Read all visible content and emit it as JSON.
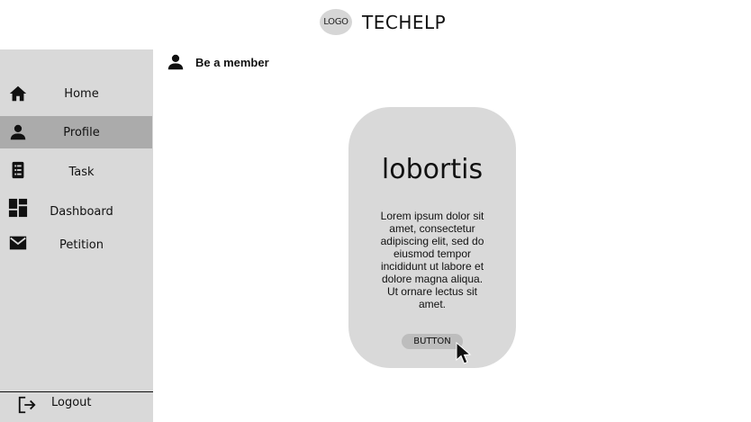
{
  "header": {
    "logo": "LOGO",
    "brand": "TECHELP"
  },
  "sidebar": {
    "items": [
      {
        "label": "Home",
        "icon": "home-icon",
        "active": false
      },
      {
        "label": "Profile",
        "icon": "person-icon",
        "active": true
      },
      {
        "label": "Task",
        "icon": "task-list-icon",
        "active": false
      },
      {
        "label": "Dashboard",
        "icon": "dashboard-icon",
        "active": false
      },
      {
        "label": "Petition",
        "icon": "mail-icon",
        "active": false
      }
    ],
    "logout": {
      "label": "Logout",
      "icon": "logout-icon"
    }
  },
  "main": {
    "member_link": "Be a member",
    "card": {
      "title": "lobortis",
      "body": "Lorem ipsum dolor sit amet, consectetur adipiscing elit, sed do eiusmod tempor incididunt ut labore et dolore magna aliqua. Ut ornare lectus sit amet.",
      "button": "BUTTON"
    }
  },
  "colors": {
    "sidebar": "#d9d9d9",
    "active_item": "#ababab",
    "card": "#d9d9d9",
    "button": "#bdbdbd"
  }
}
